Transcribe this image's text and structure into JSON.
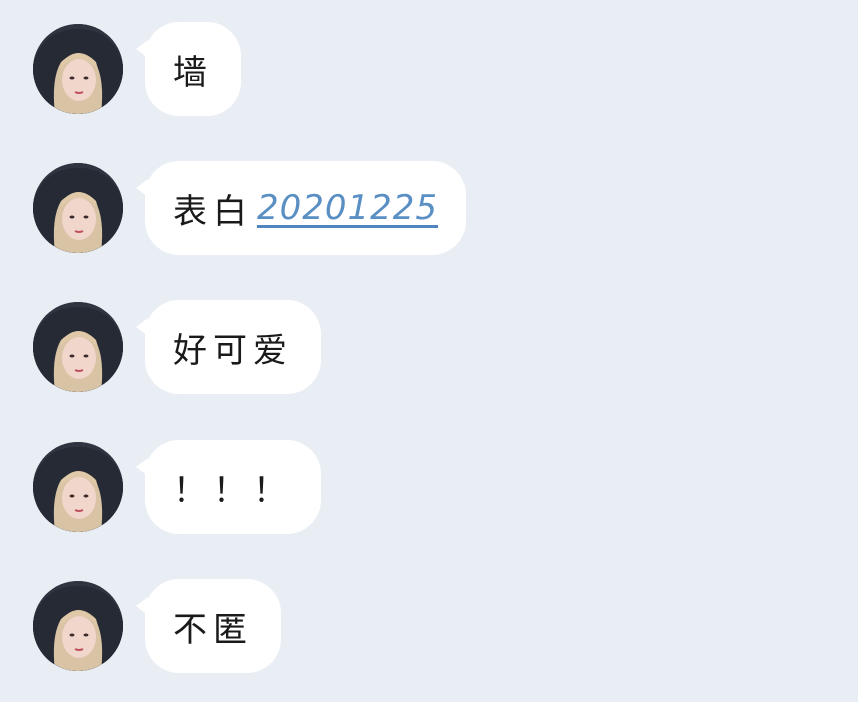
{
  "messages": [
    {
      "text": "墙"
    },
    {
      "text": "表白",
      "link": "20201225"
    },
    {
      "text": "好可爱"
    },
    {
      "text": "！！！"
    },
    {
      "text": "不匿"
    }
  ],
  "colors": {
    "background": "#e9edf4",
    "bubble": "#ffffff",
    "link": "#5a8fc4"
  },
  "icons": {
    "avatar": "avatar-girl-hood-icon"
  }
}
